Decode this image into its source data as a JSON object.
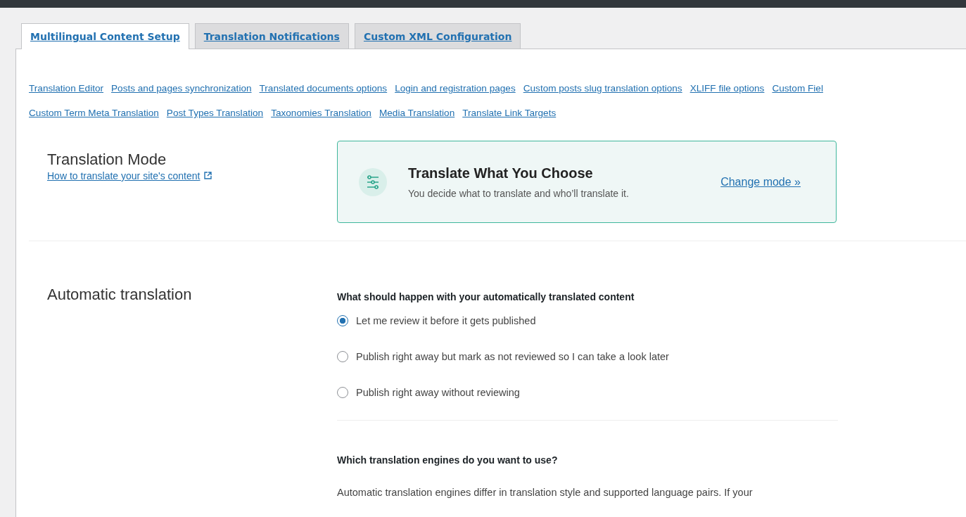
{
  "tabs": [
    {
      "label": "Multilingual Content Setup",
      "selected": true
    },
    {
      "label": "Translation Notifications",
      "selected": false
    },
    {
      "label": "Custom XML Configuration",
      "selected": false
    }
  ],
  "section_links": [
    [
      "Translation Editor",
      "Posts and pages synchronization",
      "Translated documents options",
      "Login and registration pages",
      "Custom posts slug translation options",
      "XLIFF file options",
      "Custom Fiel"
    ],
    [
      "Custom Term Meta Translation",
      "Post Types Translation",
      "Taxonomies Translation",
      "Media Translation",
      "Translate Link Targets"
    ]
  ],
  "translation_mode": {
    "heading": "Translation Mode",
    "help_link": "How to translate your site's content",
    "card": {
      "title": "Translate What You Choose",
      "description": "You decide what to translate and who’ll translate it.",
      "action": "Change mode »"
    }
  },
  "automatic_translation": {
    "heading": "Automatic translation",
    "question": "What should happen with your automatically translated content",
    "options": [
      {
        "label": "Let me review it before it gets published",
        "selected": true
      },
      {
        "label": "Publish right away but mark as not reviewed so I can take a look later",
        "selected": false
      },
      {
        "label": "Publish right away without reviewing",
        "selected": false
      }
    ],
    "engines_question": "Which translation engines do you want to use?",
    "engines_description": "Automatic translation engines differ in translation style and supported language pairs. If your"
  }
}
